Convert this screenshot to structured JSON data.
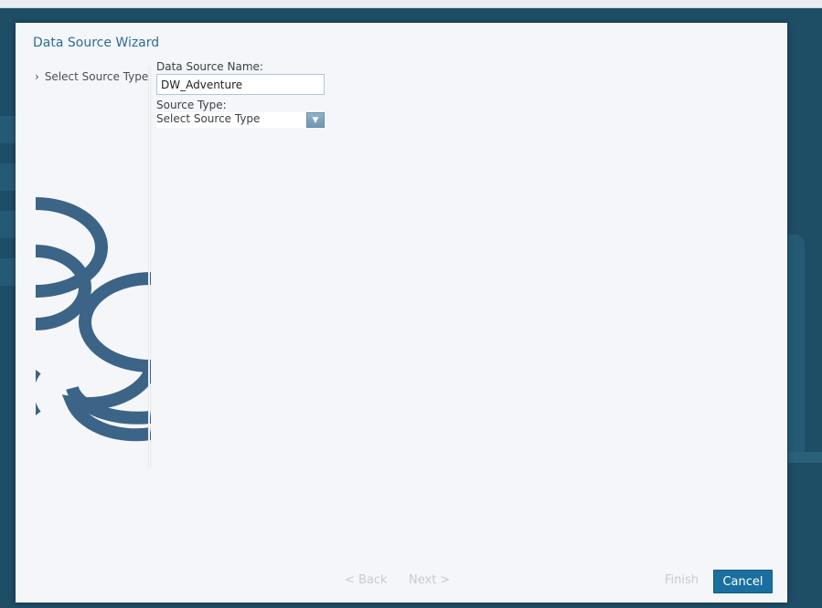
{
  "wizard": {
    "title": "Data Source Wizard",
    "steps": [
      {
        "label": "Select Source Type",
        "icon": "chevron-right-icon"
      }
    ]
  },
  "form": {
    "name_label": "Data Source Name:",
    "name_value": "DW_Adventure",
    "type_label": "Source Type:",
    "type_selected": "Select Source Type"
  },
  "footer": {
    "back_label": "< Back",
    "next_label": "Next >",
    "finish_label": "Finish",
    "cancel_label": "Cancel"
  },
  "colors": {
    "accent": "#1b6fa0",
    "title": "#2b6d98",
    "logo": "#3c6486"
  }
}
